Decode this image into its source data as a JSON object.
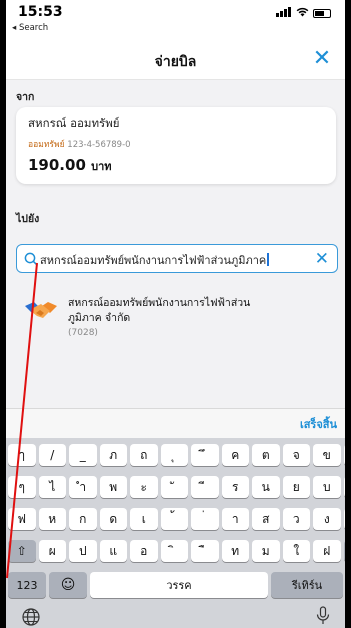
{
  "status_bar": {
    "time": "15:53",
    "back_label": "◂ Search"
  },
  "nav": {
    "title": "จ่ายบิล",
    "close_symbol": "✕"
  },
  "from": {
    "section_label": "จาก",
    "name": "สหกรณ์ ออมทรัพย์",
    "account_type": "ออมทรัพย์",
    "account_number": "123-4-56789-0",
    "amount": "190.00",
    "unit": "บาท"
  },
  "to": {
    "section_label": "ไปยัง"
  },
  "search": {
    "value": "สหกรณ์ออมทรัพย์พนักงานการไฟฟ้าส่วนภูมิภาค",
    "clear_symbol": "✕"
  },
  "result": {
    "name_line1": "สหกรณ์ออมทรัพย์พนักงานการไฟฟ้าส่วน",
    "name_line2": "ภูมิภาค จำกัด",
    "code": "(7028)",
    "icon": "handshake-icon"
  },
  "accessory": {
    "done_label": "เสร็จสิ้น"
  },
  "keyboard": {
    "row1": [
      "ๅ",
      "/",
      "_",
      "ภ",
      "ถ",
      "ุ",
      "ึ",
      "ค",
      "ต",
      "จ",
      "ข",
      "ช"
    ],
    "row2": [
      "ๆ",
      "ไ",
      "ำ",
      "พ",
      "ะ",
      "ั",
      "ี",
      "ร",
      "น",
      "ย",
      "บ",
      "ล"
    ],
    "row3": [
      "ฟ",
      "ห",
      "ก",
      "ด",
      "เ",
      "้",
      "่",
      "า",
      "ส",
      "ว",
      "ง",
      "ข"
    ],
    "row4": [
      "ผ",
      "ป",
      "แ",
      "อ",
      "ิ",
      "ื",
      "ท",
      "ม",
      "ใ",
      "ฝ"
    ],
    "shift_symbol": "⇧",
    "delete_symbol": "⌫",
    "numbers_label": "123",
    "emoji_symbol": "☺",
    "space_label": "วรรค",
    "return_label": "รีเทิร์น"
  },
  "colors": {
    "accent": "#1e8fd6",
    "account_type": "#c46a17",
    "pointer": "#e01010"
  }
}
